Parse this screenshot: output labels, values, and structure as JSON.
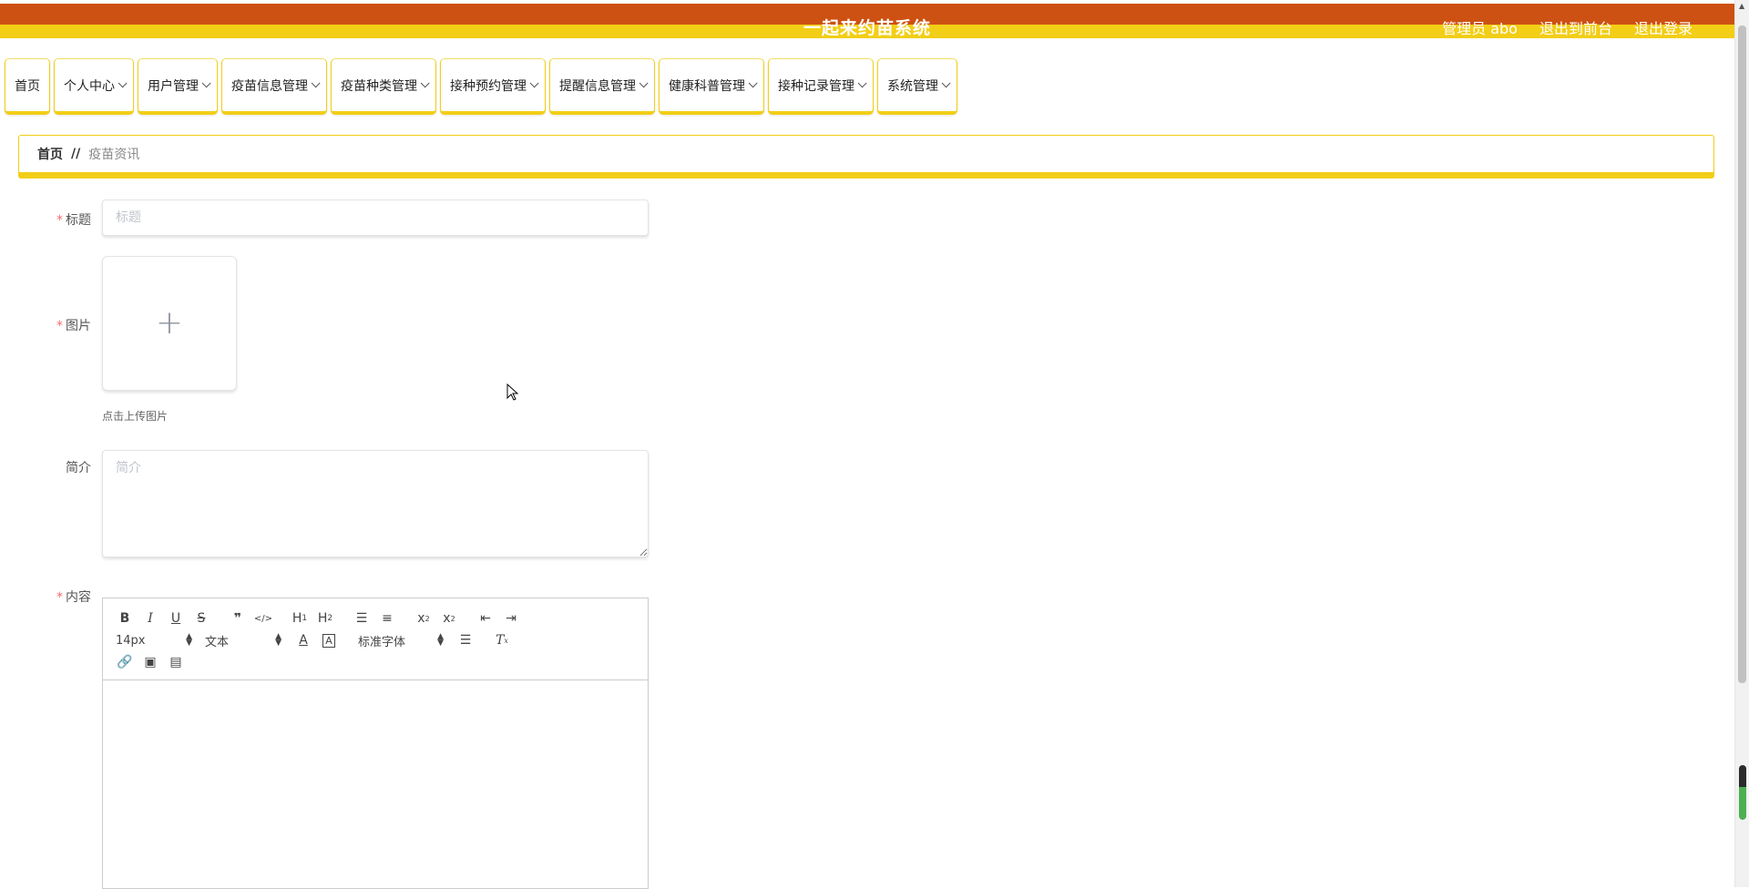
{
  "header": {
    "title": "一起来约苗系统",
    "user": "管理员 abo",
    "to_front": "退出到前台",
    "logout": "退出登录"
  },
  "menu": [
    {
      "label": "首页",
      "dropdown": false
    },
    {
      "label": "个人中心",
      "dropdown": true
    },
    {
      "label": "用户管理",
      "dropdown": true
    },
    {
      "label": "疫苗信息管理",
      "dropdown": true
    },
    {
      "label": "疫苗种类管理",
      "dropdown": true
    },
    {
      "label": "接种预约管理",
      "dropdown": true
    },
    {
      "label": "提醒信息管理",
      "dropdown": true
    },
    {
      "label": "健康科普管理",
      "dropdown": true
    },
    {
      "label": "接种记录管理",
      "dropdown": true
    },
    {
      "label": "系统管理",
      "dropdown": true
    }
  ],
  "breadcrumb": {
    "home": "首页",
    "separator": "//",
    "current": "疫苗资讯"
  },
  "form": {
    "title_label": "标题",
    "title_placeholder": "标题",
    "image_label": "图片",
    "image_hint": "点击上传图片",
    "intro_label": "简介",
    "intro_placeholder": "简介",
    "content_label": "内容",
    "required_mark": "*"
  },
  "editor": {
    "font_size": "14px",
    "header_select": "文本",
    "font_family": "标准字体"
  },
  "colors": {
    "header_bg": "#cd5112",
    "accent": "#f2ce16"
  }
}
